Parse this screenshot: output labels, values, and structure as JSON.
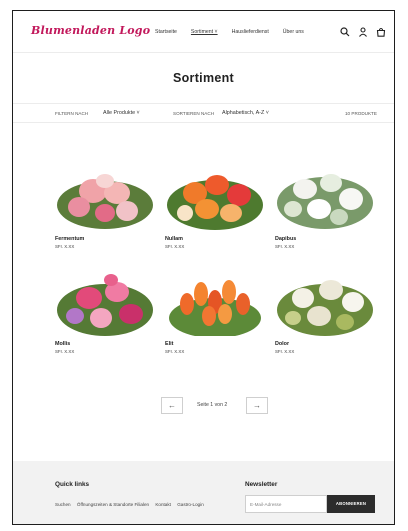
{
  "header": {
    "logo": "Blumenladen Logo",
    "nav": [
      "Startseite",
      "Sortiment ˅",
      "Hauslieferdienst",
      "Über uns"
    ],
    "icons": [
      "search-icon",
      "account-icon",
      "cart-icon"
    ]
  },
  "page": {
    "title": "Sortiment"
  },
  "filters": {
    "filter_label": "FILTERN NACH",
    "filter_value": "Alle Produkte ˅",
    "sort_label": "SORTIEREN NACH",
    "sort_value": "Alphabetisch, A-Z ˅",
    "count": "10 PRODUKTE"
  },
  "products": [
    {
      "name": "Fermentum",
      "price": "SFr. X.XX"
    },
    {
      "name": "Nullam",
      "price": "SFr. X.XX"
    },
    {
      "name": "Dapibus",
      "price": "SFr. X.XX"
    },
    {
      "name": "Mollis",
      "price": "SFr. X.XX"
    },
    {
      "name": "Elit",
      "price": "SFr. X.XX"
    },
    {
      "name": "Dolor",
      "price": "SFr. X.XX"
    }
  ],
  "pagination": {
    "prev": "←",
    "text": "Seite 1 von 2",
    "next": "→"
  },
  "footer": {
    "quick_links_title": "Quick links",
    "links": [
      "Suchen",
      "Öffnungszeiten & Standorte Filialen",
      "Kontakt",
      "Gastro-Login"
    ],
    "newsletter_title": "Newsletter",
    "email_placeholder": "E-Mail-Adresse",
    "subscribe_label": "ABONNIEREN"
  },
  "colors": {
    "brand": "#c2185b",
    "footer_bg": "#f2f2f2",
    "button_bg": "#2c2c2c"
  }
}
